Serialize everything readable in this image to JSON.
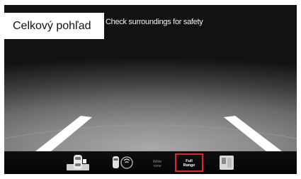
{
  "view_title": "Celkový pohľad",
  "warning": "Check surroundings for safety",
  "toolbar": {
    "overhead_view": {
      "icon": "car-overhead-icon",
      "active": false
    },
    "parking_sensor": {
      "icon": "parking-sensor-icon",
      "active": false
    },
    "wide_view": {
      "label": "Wide\nview",
      "active": false
    },
    "full_range": {
      "label": "Full\nRange",
      "active": true
    },
    "side_view": {
      "icon": "side-view-icon",
      "active": false
    }
  },
  "colors": {
    "active_border": "#e3242b",
    "guide_lines": "#ffffff",
    "title_bg": "#ffffff"
  }
}
